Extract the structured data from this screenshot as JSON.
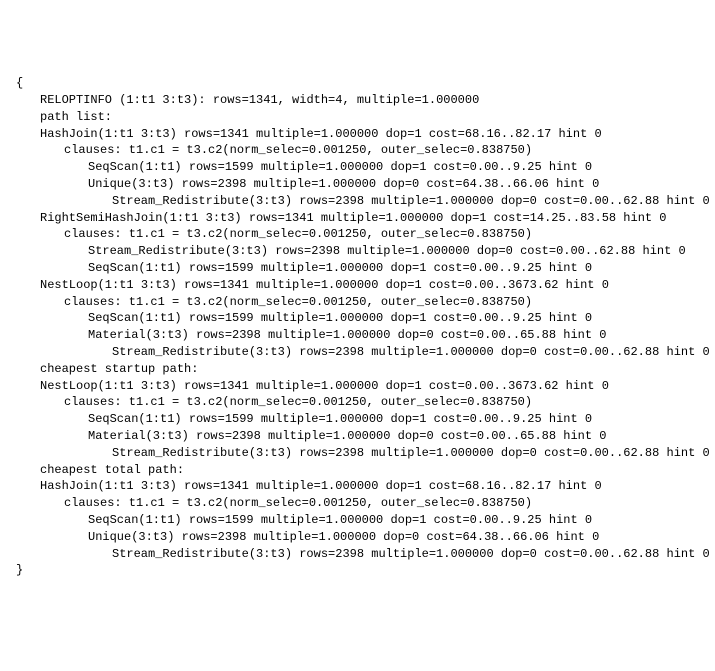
{
  "lines": [
    {
      "indent": 0,
      "text": "{"
    },
    {
      "indent": 1,
      "text": "RELOPTINFO (1:t1 3:t3): rows=1341, width=4, multiple=1.000000"
    },
    {
      "indent": 1,
      "text": "path list:"
    },
    {
      "indent": 1,
      "text": "HashJoin(1:t1 3:t3) rows=1341 multiple=1.000000 dop=1 cost=68.16..82.17 hint 0"
    },
    {
      "indent": 2,
      "text": "clauses: t1.c1 = t3.c2(norm_selec=0.001250, outer_selec=0.838750)"
    },
    {
      "indent": 3,
      "text": "SeqScan(1:t1) rows=1599 multiple=1.000000 dop=1 cost=0.00..9.25 hint 0"
    },
    {
      "indent": 3,
      "text": "Unique(3:t3) rows=2398 multiple=1.000000 dop=0 cost=64.38..66.06 hint 0"
    },
    {
      "indent": 4,
      "text": "Stream_Redistribute(3:t3) rows=2398 multiple=1.000000 dop=0 cost=0.00..62.88 hint 0"
    },
    {
      "indent": 1,
      "text": "RightSemiHashJoin(1:t1 3:t3) rows=1341 multiple=1.000000 dop=1 cost=14.25..83.58 hint 0"
    },
    {
      "indent": 2,
      "text": "clauses: t1.c1 = t3.c2(norm_selec=0.001250, outer_selec=0.838750)"
    },
    {
      "indent": 3,
      "text": "Stream_Redistribute(3:t3) rows=2398 multiple=1.000000 dop=0 cost=0.00..62.88 hint 0"
    },
    {
      "indent": 3,
      "text": "SeqScan(1:t1) rows=1599 multiple=1.000000 dop=1 cost=0.00..9.25 hint 0"
    },
    {
      "indent": 1,
      "text": "NestLoop(1:t1 3:t3) rows=1341 multiple=1.000000 dop=1 cost=0.00..3673.62 hint 0"
    },
    {
      "indent": 2,
      "text": "clauses: t1.c1 = t3.c2(norm_selec=0.001250, outer_selec=0.838750)"
    },
    {
      "indent": 3,
      "text": "SeqScan(1:t1) rows=1599 multiple=1.000000 dop=1 cost=0.00..9.25 hint 0"
    },
    {
      "indent": 3,
      "text": "Material(3:t3) rows=2398 multiple=1.000000 dop=0 cost=0.00..65.88 hint 0"
    },
    {
      "indent": 4,
      "text": "Stream_Redistribute(3:t3) rows=2398 multiple=1.000000 dop=0 cost=0.00..62.88 hint 0"
    },
    {
      "indent": 1,
      "text": ""
    },
    {
      "indent": 1,
      "text": "cheapest startup path:"
    },
    {
      "indent": 1,
      "text": "NestLoop(1:t1 3:t3) rows=1341 multiple=1.000000 dop=1 cost=0.00..3673.62 hint 0"
    },
    {
      "indent": 2,
      "text": "clauses: t1.c1 = t3.c2(norm_selec=0.001250, outer_selec=0.838750)"
    },
    {
      "indent": 3,
      "text": "SeqScan(1:t1) rows=1599 multiple=1.000000 dop=1 cost=0.00..9.25 hint 0"
    },
    {
      "indent": 3,
      "text": "Material(3:t3) rows=2398 multiple=1.000000 dop=0 cost=0.00..65.88 hint 0"
    },
    {
      "indent": 4,
      "text": "Stream_Redistribute(3:t3) rows=2398 multiple=1.000000 dop=0 cost=0.00..62.88 hint 0"
    },
    {
      "indent": 1,
      "text": ""
    },
    {
      "indent": 1,
      "text": "cheapest total path:"
    },
    {
      "indent": 1,
      "text": "HashJoin(1:t1 3:t3) rows=1341 multiple=1.000000 dop=1 cost=68.16..82.17 hint 0"
    },
    {
      "indent": 2,
      "text": "clauses: t1.c1 = t3.c2(norm_selec=0.001250, outer_selec=0.838750)"
    },
    {
      "indent": 3,
      "text": "SeqScan(1:t1) rows=1599 multiple=1.000000 dop=1 cost=0.00..9.25 hint 0"
    },
    {
      "indent": 3,
      "text": "Unique(3:t3) rows=2398 multiple=1.000000 dop=0 cost=64.38..66.06 hint 0"
    },
    {
      "indent": 4,
      "text": "Stream_Redistribute(3:t3) rows=2398 multiple=1.000000 dop=0 cost=0.00..62.88 hint 0"
    },
    {
      "indent": 1,
      "text": ""
    },
    {
      "indent": 0,
      "text": "}"
    }
  ]
}
